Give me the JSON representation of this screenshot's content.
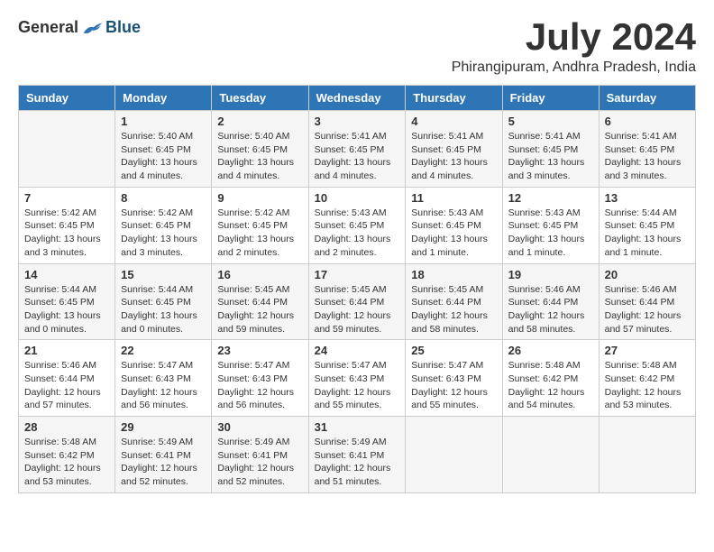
{
  "logo": {
    "general": "General",
    "blue": "Blue"
  },
  "title": "July 2024",
  "location": "Phirangipuram, Andhra Pradesh, India",
  "columns": [
    "Sunday",
    "Monday",
    "Tuesday",
    "Wednesday",
    "Thursday",
    "Friday",
    "Saturday"
  ],
  "weeks": [
    [
      {
        "day": "",
        "sunrise": "",
        "sunset": "",
        "daylight": ""
      },
      {
        "day": "1",
        "sunrise": "Sunrise: 5:40 AM",
        "sunset": "Sunset: 6:45 PM",
        "daylight": "Daylight: 13 hours and 4 minutes."
      },
      {
        "day": "2",
        "sunrise": "Sunrise: 5:40 AM",
        "sunset": "Sunset: 6:45 PM",
        "daylight": "Daylight: 13 hours and 4 minutes."
      },
      {
        "day": "3",
        "sunrise": "Sunrise: 5:41 AM",
        "sunset": "Sunset: 6:45 PM",
        "daylight": "Daylight: 13 hours and 4 minutes."
      },
      {
        "day": "4",
        "sunrise": "Sunrise: 5:41 AM",
        "sunset": "Sunset: 6:45 PM",
        "daylight": "Daylight: 13 hours and 4 minutes."
      },
      {
        "day": "5",
        "sunrise": "Sunrise: 5:41 AM",
        "sunset": "Sunset: 6:45 PM",
        "daylight": "Daylight: 13 hours and 3 minutes."
      },
      {
        "day": "6",
        "sunrise": "Sunrise: 5:41 AM",
        "sunset": "Sunset: 6:45 PM",
        "daylight": "Daylight: 13 hours and 3 minutes."
      }
    ],
    [
      {
        "day": "7",
        "sunrise": "Sunrise: 5:42 AM",
        "sunset": "Sunset: 6:45 PM",
        "daylight": "Daylight: 13 hours and 3 minutes."
      },
      {
        "day": "8",
        "sunrise": "Sunrise: 5:42 AM",
        "sunset": "Sunset: 6:45 PM",
        "daylight": "Daylight: 13 hours and 3 minutes."
      },
      {
        "day": "9",
        "sunrise": "Sunrise: 5:42 AM",
        "sunset": "Sunset: 6:45 PM",
        "daylight": "Daylight: 13 hours and 2 minutes."
      },
      {
        "day": "10",
        "sunrise": "Sunrise: 5:43 AM",
        "sunset": "Sunset: 6:45 PM",
        "daylight": "Daylight: 13 hours and 2 minutes."
      },
      {
        "day": "11",
        "sunrise": "Sunrise: 5:43 AM",
        "sunset": "Sunset: 6:45 PM",
        "daylight": "Daylight: 13 hours and 1 minute."
      },
      {
        "day": "12",
        "sunrise": "Sunrise: 5:43 AM",
        "sunset": "Sunset: 6:45 PM",
        "daylight": "Daylight: 13 hours and 1 minute."
      },
      {
        "day": "13",
        "sunrise": "Sunrise: 5:44 AM",
        "sunset": "Sunset: 6:45 PM",
        "daylight": "Daylight: 13 hours and 1 minute."
      }
    ],
    [
      {
        "day": "14",
        "sunrise": "Sunrise: 5:44 AM",
        "sunset": "Sunset: 6:45 PM",
        "daylight": "Daylight: 13 hours and 0 minutes."
      },
      {
        "day": "15",
        "sunrise": "Sunrise: 5:44 AM",
        "sunset": "Sunset: 6:45 PM",
        "daylight": "Daylight: 13 hours and 0 minutes."
      },
      {
        "day": "16",
        "sunrise": "Sunrise: 5:45 AM",
        "sunset": "Sunset: 6:44 PM",
        "daylight": "Daylight: 12 hours and 59 minutes."
      },
      {
        "day": "17",
        "sunrise": "Sunrise: 5:45 AM",
        "sunset": "Sunset: 6:44 PM",
        "daylight": "Daylight: 12 hours and 59 minutes."
      },
      {
        "day": "18",
        "sunrise": "Sunrise: 5:45 AM",
        "sunset": "Sunset: 6:44 PM",
        "daylight": "Daylight: 12 hours and 58 minutes."
      },
      {
        "day": "19",
        "sunrise": "Sunrise: 5:46 AM",
        "sunset": "Sunset: 6:44 PM",
        "daylight": "Daylight: 12 hours and 58 minutes."
      },
      {
        "day": "20",
        "sunrise": "Sunrise: 5:46 AM",
        "sunset": "Sunset: 6:44 PM",
        "daylight": "Daylight: 12 hours and 57 minutes."
      }
    ],
    [
      {
        "day": "21",
        "sunrise": "Sunrise: 5:46 AM",
        "sunset": "Sunset: 6:44 PM",
        "daylight": "Daylight: 12 hours and 57 minutes."
      },
      {
        "day": "22",
        "sunrise": "Sunrise: 5:47 AM",
        "sunset": "Sunset: 6:43 PM",
        "daylight": "Daylight: 12 hours and 56 minutes."
      },
      {
        "day": "23",
        "sunrise": "Sunrise: 5:47 AM",
        "sunset": "Sunset: 6:43 PM",
        "daylight": "Daylight: 12 hours and 56 minutes."
      },
      {
        "day": "24",
        "sunrise": "Sunrise: 5:47 AM",
        "sunset": "Sunset: 6:43 PM",
        "daylight": "Daylight: 12 hours and 55 minutes."
      },
      {
        "day": "25",
        "sunrise": "Sunrise: 5:47 AM",
        "sunset": "Sunset: 6:43 PM",
        "daylight": "Daylight: 12 hours and 55 minutes."
      },
      {
        "day": "26",
        "sunrise": "Sunrise: 5:48 AM",
        "sunset": "Sunset: 6:42 PM",
        "daylight": "Daylight: 12 hours and 54 minutes."
      },
      {
        "day": "27",
        "sunrise": "Sunrise: 5:48 AM",
        "sunset": "Sunset: 6:42 PM",
        "daylight": "Daylight: 12 hours and 53 minutes."
      }
    ],
    [
      {
        "day": "28",
        "sunrise": "Sunrise: 5:48 AM",
        "sunset": "Sunset: 6:42 PM",
        "daylight": "Daylight: 12 hours and 53 minutes."
      },
      {
        "day": "29",
        "sunrise": "Sunrise: 5:49 AM",
        "sunset": "Sunset: 6:41 PM",
        "daylight": "Daylight: 12 hours and 52 minutes."
      },
      {
        "day": "30",
        "sunrise": "Sunrise: 5:49 AM",
        "sunset": "Sunset: 6:41 PM",
        "daylight": "Daylight: 12 hours and 52 minutes."
      },
      {
        "day": "31",
        "sunrise": "Sunrise: 5:49 AM",
        "sunset": "Sunset: 6:41 PM",
        "daylight": "Daylight: 12 hours and 51 minutes."
      },
      {
        "day": "",
        "sunrise": "",
        "sunset": "",
        "daylight": ""
      },
      {
        "day": "",
        "sunrise": "",
        "sunset": "",
        "daylight": ""
      },
      {
        "day": "",
        "sunrise": "",
        "sunset": "",
        "daylight": ""
      }
    ]
  ]
}
